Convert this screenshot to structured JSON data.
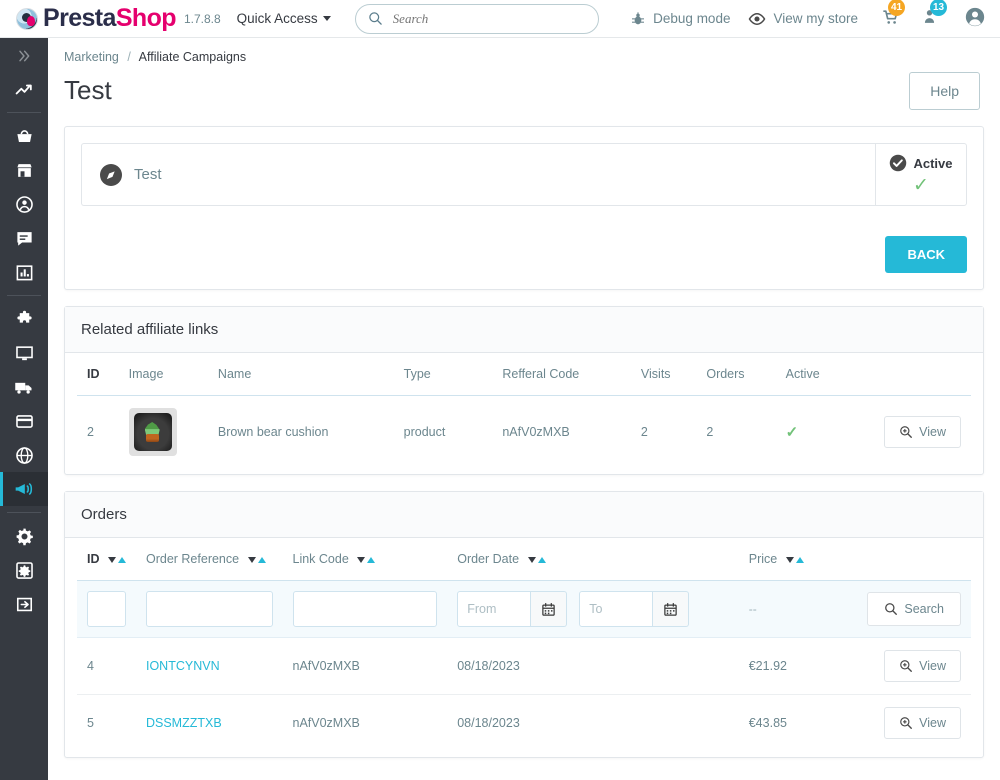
{
  "header": {
    "brand_part1": "Presta",
    "brand_part2": "Shop",
    "version": "1.7.8.8",
    "quick_access": "Quick Access",
    "search_placeholder": "Search",
    "search_value": "",
    "debug_mode": "Debug mode",
    "view_store": "View my store",
    "badge_orders": "41",
    "badge_customers": "13"
  },
  "sidebar": {
    "items": [
      {
        "name": "collapse",
        "icon": "chevron-double-right-icon"
      },
      {
        "name": "dashboard",
        "icon": "trending-up-icon"
      },
      {
        "name": "orders",
        "icon": "basket-icon"
      },
      {
        "name": "catalog",
        "icon": "store-icon"
      },
      {
        "name": "customers",
        "icon": "user-circle-icon"
      },
      {
        "name": "customer-service",
        "icon": "speech-bubble-icon"
      },
      {
        "name": "stats",
        "icon": "bar-chart-icon"
      },
      {
        "name": "modules",
        "icon": "puzzle-icon"
      },
      {
        "name": "design",
        "icon": "desktop-icon"
      },
      {
        "name": "shipping",
        "icon": "truck-icon"
      },
      {
        "name": "payment",
        "icon": "credit-card-icon"
      },
      {
        "name": "international",
        "icon": "globe-icon"
      },
      {
        "name": "marketing",
        "icon": "megaphone-icon"
      },
      {
        "name": "shop-parameters",
        "icon": "gear-icon"
      },
      {
        "name": "advanced-parameters",
        "icon": "gear-square-icon"
      },
      {
        "name": "logout",
        "icon": "logout-icon"
      }
    ]
  },
  "breadcrumb": {
    "parent": "Marketing",
    "separator": "/",
    "current": "Affiliate Campaigns"
  },
  "page": {
    "title": "Test",
    "help_label": "Help"
  },
  "campaign": {
    "name": "Test",
    "status_label": "Active",
    "back_label": "BACK"
  },
  "affiliate_links": {
    "panel_title": "Related affiliate links",
    "columns": [
      "ID",
      "Image",
      "Name",
      "Type",
      "Refferal Code",
      "Visits",
      "Orders",
      "Active",
      ""
    ],
    "rows": [
      {
        "id": "2",
        "name": "Brown bear cushion",
        "type": "product",
        "referral_code": "nAfV0zMXB",
        "visits": "2",
        "orders": "2",
        "active": true,
        "view_label": "View"
      }
    ]
  },
  "orders": {
    "panel_title": "Orders",
    "columns": [
      "ID",
      "Order Reference",
      "Link Code",
      "Order Date",
      "Price",
      ""
    ],
    "filters": {
      "id": "",
      "order_reference": "",
      "link_code": "",
      "date_from_placeholder": "From",
      "date_from": "",
      "date_to_placeholder": "To",
      "date_to": "",
      "price_placeholder": "--",
      "search_label": "Search"
    },
    "rows": [
      {
        "id": "4",
        "order_reference": "IONTCYNVN",
        "link_code": "nAfV0zMXB",
        "order_date": "08/18/2023",
        "price": "€21.92",
        "view_label": "View"
      },
      {
        "id": "5",
        "order_reference": "DSSMZZTXB",
        "link_code": "nAfV0zMXB",
        "order_date": "08/18/2023",
        "price": "€43.85",
        "view_label": "View"
      }
    ]
  },
  "colors": {
    "accent": "#25b9d7",
    "sidebar": "#363a41",
    "brand_pink": "#e5006e",
    "success_green": "#72c279",
    "badge_orange": "#f5a623"
  }
}
